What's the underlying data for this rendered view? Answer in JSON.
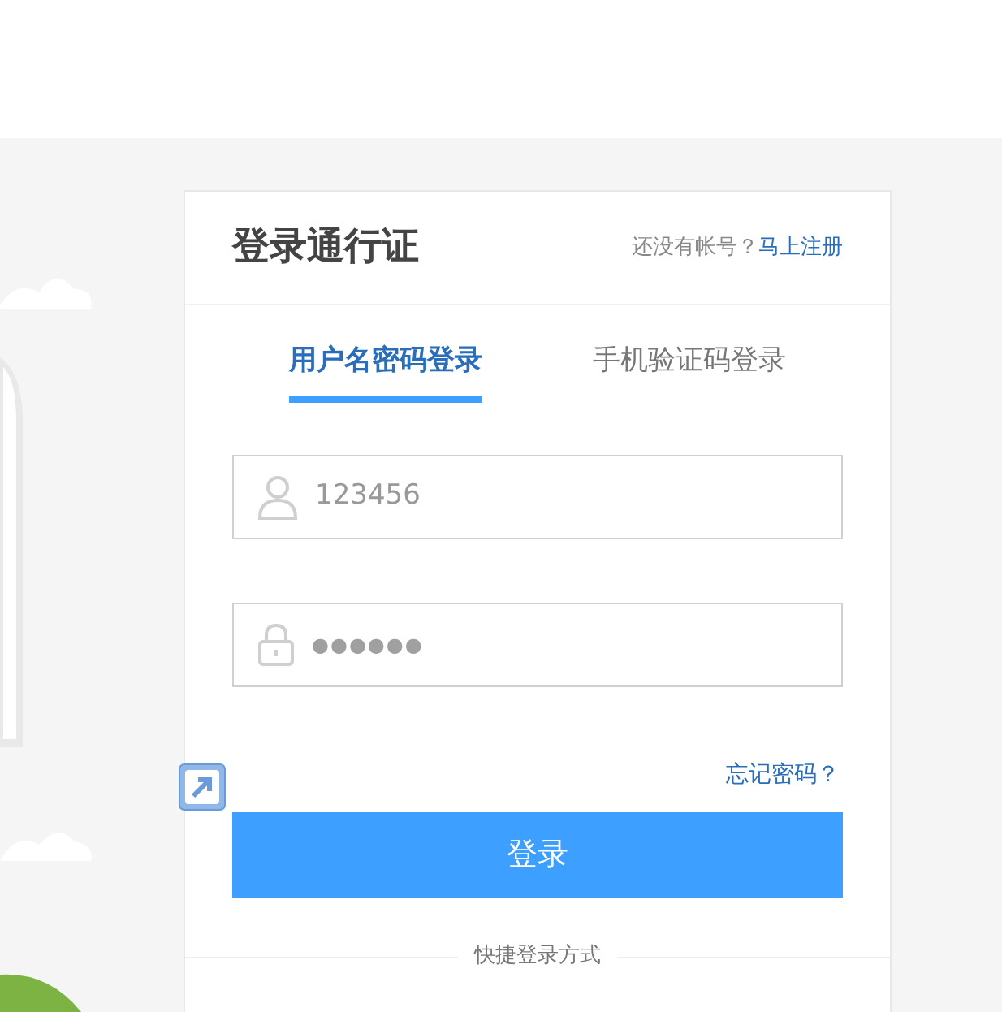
{
  "header": {
    "title": "登录通行证",
    "register_prompt": "还没有帐号？",
    "register_link": "马上注册"
  },
  "tabs": [
    {
      "label": "用户名密码登录",
      "selected": true
    },
    {
      "label": "手机验证码登录",
      "selected": false
    }
  ],
  "username": {
    "value": "123456"
  },
  "password": {
    "value": "●●●●●●"
  },
  "forgot_link": "忘记密码？",
  "login_button": "登录",
  "quick_login_label": "快捷登录方式"
}
